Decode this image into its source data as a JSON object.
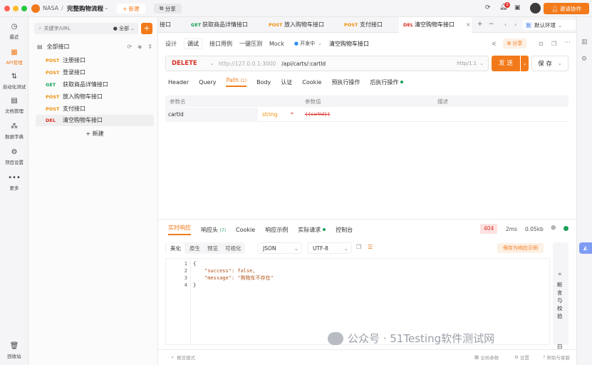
{
  "titlebar": {
    "workspace": "NASA",
    "separator": "/",
    "project": "完整购物流程",
    "new_label": "新建",
    "share_label": "分享",
    "notification_count": "3",
    "invite_label": "邀请协作"
  },
  "rail": [
    {
      "label": "最近",
      "icon": "clock-icon"
    },
    {
      "label": "API管理",
      "icon": "api-icon"
    },
    {
      "label": "自动化测试",
      "icon": "flow-icon"
    },
    {
      "label": "文档管理",
      "icon": "doc-icon"
    },
    {
      "label": "数据字典",
      "icon": "dict-icon"
    },
    {
      "label": "项目设置",
      "icon": "settings-icon"
    },
    {
      "label": "更多",
      "icon": "more-icon"
    },
    {
      "label": "回收站",
      "icon": "trash-icon"
    }
  ],
  "sidebar": {
    "search_placeholder": "关键字/URL",
    "filter_label": "全部",
    "root_label": "全部接口",
    "items": [
      {
        "method": "POST",
        "name": "注册接口"
      },
      {
        "method": "POST",
        "name": "登录接口"
      },
      {
        "method": "GET",
        "name": "获取商品详情接口"
      },
      {
        "method": "POST",
        "name": "放入购物车接口"
      },
      {
        "method": "POST",
        "name": "支付接口"
      },
      {
        "method": "DEL",
        "name": "清空购物车接口"
      }
    ],
    "new_label": "+ 新建"
  },
  "tabs": [
    {
      "method": "",
      "name": "接口"
    },
    {
      "method": "GET",
      "name": "获取商品详情接口"
    },
    {
      "method": "POST",
      "name": "放入购物车接口"
    },
    {
      "method": "POST",
      "name": "支付接口"
    },
    {
      "method": "DEL",
      "name": "清空购物车接口"
    }
  ],
  "env_label": "默认环境",
  "env_badge": "数",
  "subtabs": [
    "设计",
    "调试",
    "接口用例",
    "一键压测",
    "Mock"
  ],
  "dev_status": "开发中",
  "api_title": "清空购物车接口",
  "share_label": "分享",
  "request": {
    "method": "DELETE",
    "base_url": "http://127.0.0.1:3000",
    "path": "/api/carts/:cartId",
    "protocol": "http/1.1",
    "send_label": "发 送",
    "save_label": "保 存"
  },
  "param_tabs": [
    "Header",
    "Query",
    "Path",
    "Body",
    "认证",
    "Cookie",
    "预执行操作",
    "后执行操作"
  ],
  "path_count": "(1)",
  "params_table": {
    "headers": [
      "参数名",
      "参数值",
      "描述"
    ],
    "rows": [
      {
        "name": "cartId",
        "type": "string",
        "required": "*",
        "value": "{{cartId}}"
      }
    ]
  },
  "response": {
    "tabs": [
      "实时响应",
      "响应头",
      "Cookie",
      "响应示例",
      "实际请求",
      "控制台"
    ],
    "header_count": "(7)",
    "status": "404",
    "time": "2ms",
    "size": "0.05kb",
    "view_modes": [
      "美化",
      "原生",
      "预览",
      "可视化"
    ],
    "format": "JSON",
    "encoding": "UTF-8",
    "save_example_label": "保存为响应示例",
    "line_numbers": [
      "1",
      "2",
      "3",
      "4"
    ],
    "lines": [
      "{",
      "\"success\": false,",
      "\"message\": \"购物车不存在\"",
      "}"
    ],
    "assert_label": "断言与校验"
  },
  "footer": {
    "outline_label": "概览模式",
    "global_params": "全局参数",
    "settings": "设置",
    "help": "帮助与客服"
  },
  "watermark": "公众号 · 51Testing软件测试网",
  "colors": {
    "accent": "#f27a1a",
    "post": "#f0900c",
    "get": "#18a058",
    "delete": "#d93026"
  }
}
